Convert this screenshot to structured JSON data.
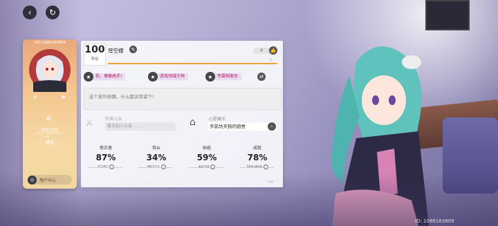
{
  "player": {
    "uid": "UID:1086183809",
    "level": "100",
    "level_label": "等级",
    "name": "穹空様",
    "birthday": "9月20日",
    "region": "湖北",
    "likes": "0",
    "exp": "-/-"
  },
  "titles": [
    {
      "label": "我，偶像高手!"
    },
    {
      "label": "游戏领域大神"
    },
    {
      "label": "专属档案员"
    }
  ],
  "message": "这个家伙很懒，什么都没有留下!",
  "guild": {
    "label": "所属公会",
    "button": "暂未加入公会"
  },
  "dorm": {
    "label": "心愿展示",
    "name": "手前坊天狗的宿舍"
  },
  "stats": [
    {
      "label": "修正者",
      "pct": "87%",
      "count": "72/82"
    },
    {
      "label": "侍从",
      "pct": "34%",
      "count": "38/111"
    },
    {
      "label": "贴纸",
      "pct": "59%",
      "count": "44/74"
    },
    {
      "label": "成就",
      "pct": "78%",
      "count": "366/464"
    }
  ],
  "user_center": "用户中心",
  "corner_tag": "FAT",
  "watermark": "ID: 1086183809",
  "icons": {
    "back": "back-arrow-icon",
    "refresh": "refresh-icon",
    "edit": "edit-icon",
    "like": "thumbs-up-icon",
    "swap": "swap-icon",
    "star": "star-icon",
    "guild": "guild-icon",
    "dorm": "house-icon",
    "go": "arrow-right-icon",
    "usercenter": "user-center-icon"
  },
  "colors": {
    "exp_bar": "#f0a030",
    "title_text": "#c2185b"
  }
}
